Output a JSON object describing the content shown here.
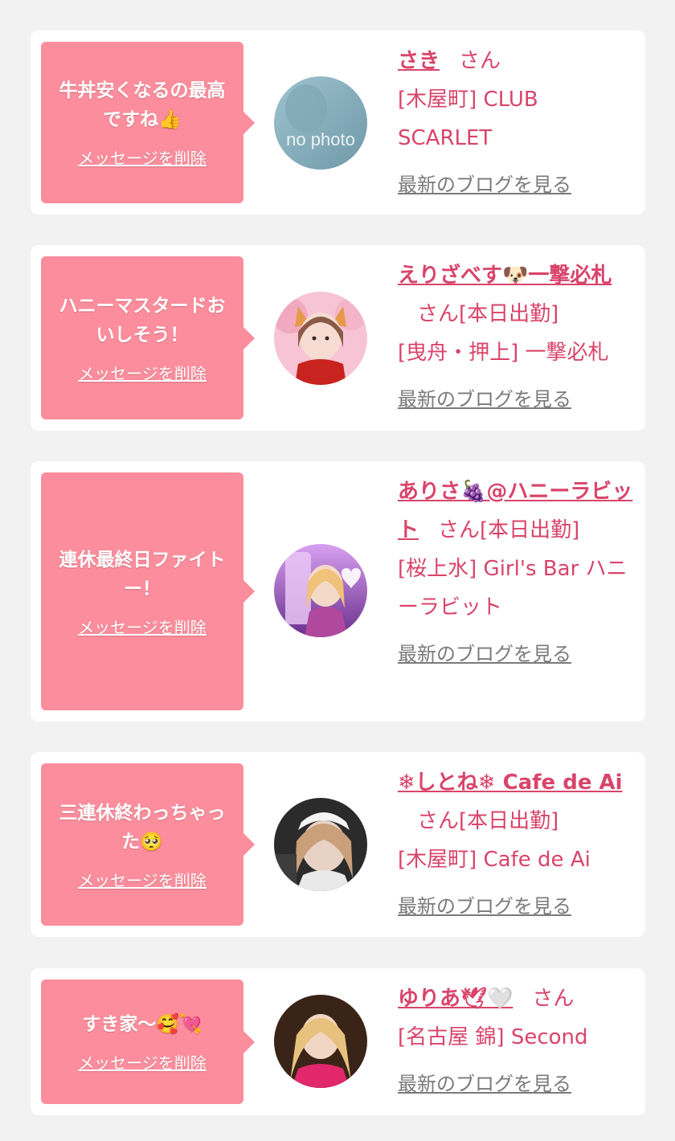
{
  "delete_label": "メッセージを削除",
  "blog_label": "最新のブログを見る",
  "san": "さん",
  "items": [
    {
      "message": "牛丼安くなるの最高ですね👍",
      "name": "さき",
      "name_suffix": "",
      "status": "",
      "shop": "[木屋町] CLUB SCARLET",
      "avatar_text": "no photo"
    },
    {
      "message": "ハニーマスタードおいしそう！",
      "name": "えりざべす🐶一撃必札",
      "status": "[本日出勤]",
      "shop": "[曳舟・押上] 一撃必札",
      "avatar_text": ""
    },
    {
      "message": "連休最終日ファイトー！",
      "name": "ありさ🍇@ハニーラビット",
      "status": "[本日出勤]",
      "shop": "[桜上水] Girl's Bar ハニーラビット",
      "avatar_text": ""
    },
    {
      "message": "三連休終わっちゃった🥺",
      "name": "❄しとね❄ Cafe de Ai",
      "status": "[本日出勤]",
      "shop": "[木屋町] Cafe de Ai",
      "avatar_text": ""
    },
    {
      "message": "すき家〜🥰💘",
      "name": "ゆりあ🕊🤍",
      "status": "",
      "shop": "[名古屋 錦] Second",
      "avatar_text": ""
    }
  ],
  "colors": {
    "bubble": "#fb8d9c",
    "accent": "#d9446a",
    "link_gray": "#7a7a7a",
    "background": "#f2f2f2"
  }
}
